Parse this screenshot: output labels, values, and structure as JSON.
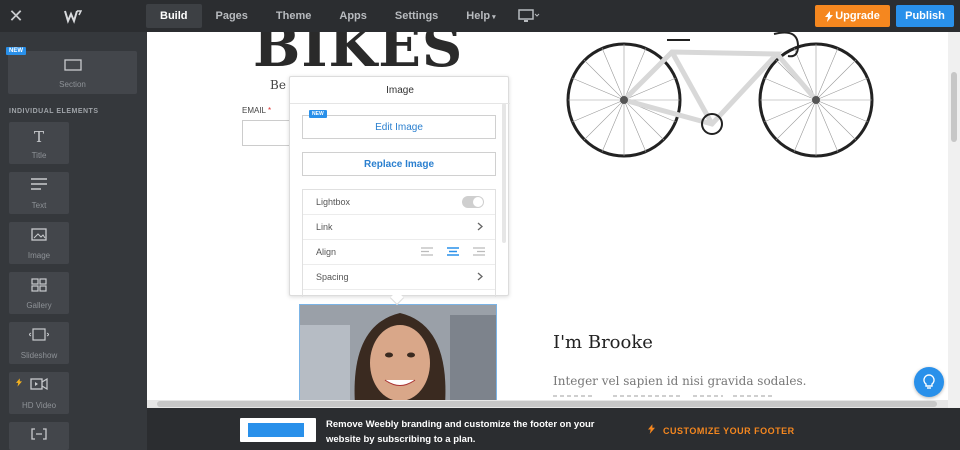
{
  "topbar": {
    "nav": [
      "Build",
      "Pages",
      "Theme",
      "Apps",
      "Settings",
      "Help"
    ],
    "upgrade_label": "Upgrade",
    "publish_label": "Publish"
  },
  "sidebar": {
    "new_badge": "NEW",
    "section_label": "Section",
    "heading": "INDIVIDUAL ELEMENTS",
    "items": [
      "Title",
      "Text",
      "Image",
      "Gallery",
      "Slideshow",
      "HD Video",
      ""
    ]
  },
  "page": {
    "title": "BIKES",
    "subtitle_partial": "Be",
    "email_label": "EMAIL",
    "email_required": "*",
    "about_heading": "I'm Brooke",
    "about_text": "Integer vel sapien id nisi gravida sodales."
  },
  "popover": {
    "title": "Image",
    "new_badge": "NEW",
    "edit_label": "Edit Image",
    "replace_label": "Replace Image",
    "rows": [
      "Lightbox",
      "Link",
      "Align",
      "Spacing"
    ],
    "lightbox_on": false,
    "align_selected": "center"
  },
  "footer": {
    "message": "Remove Weebly branding and customize the footer on your website by subscribing to a plan.",
    "cta": "CUSTOMIZE YOUR FOOTER"
  },
  "colors": {
    "accent_blue": "#2990ea",
    "upgrade_orange": "#f5871f",
    "dark_bar": "#2b2d30"
  }
}
